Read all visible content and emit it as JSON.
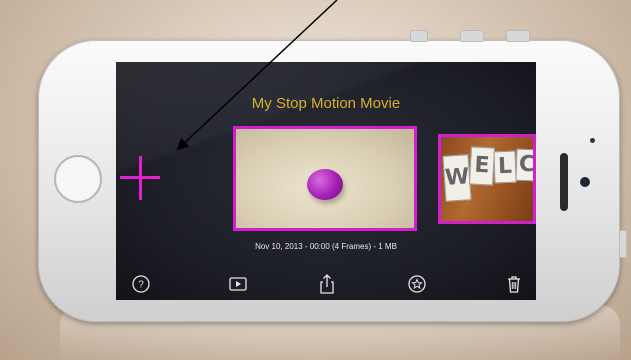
{
  "app": {
    "movie_title": "My Stop Motion Movie",
    "movie_info": "Nov 10, 2013 - 00:00 (4 Frames) - 1 MB",
    "accent_color": "#d11fcf",
    "title_color": "#d8b12a"
  },
  "frames": [
    {
      "name": "frame-1",
      "content": "purple clay ball on beige background"
    },
    {
      "name": "frame-2",
      "content": "paper letter tiles on wood"
    }
  ],
  "frame2_tiles": [
    "W",
    "E",
    "L",
    "C"
  ],
  "toolbar": [
    {
      "name": "help-button",
      "icon": "question-icon"
    },
    {
      "name": "play-button",
      "icon": "play-icon"
    },
    {
      "name": "share-button",
      "icon": "share-icon"
    },
    {
      "name": "favorite-button",
      "icon": "star-icon"
    },
    {
      "name": "delete-button",
      "icon": "trash-icon"
    }
  ],
  "add_button": {
    "icon": "plus-icon"
  }
}
